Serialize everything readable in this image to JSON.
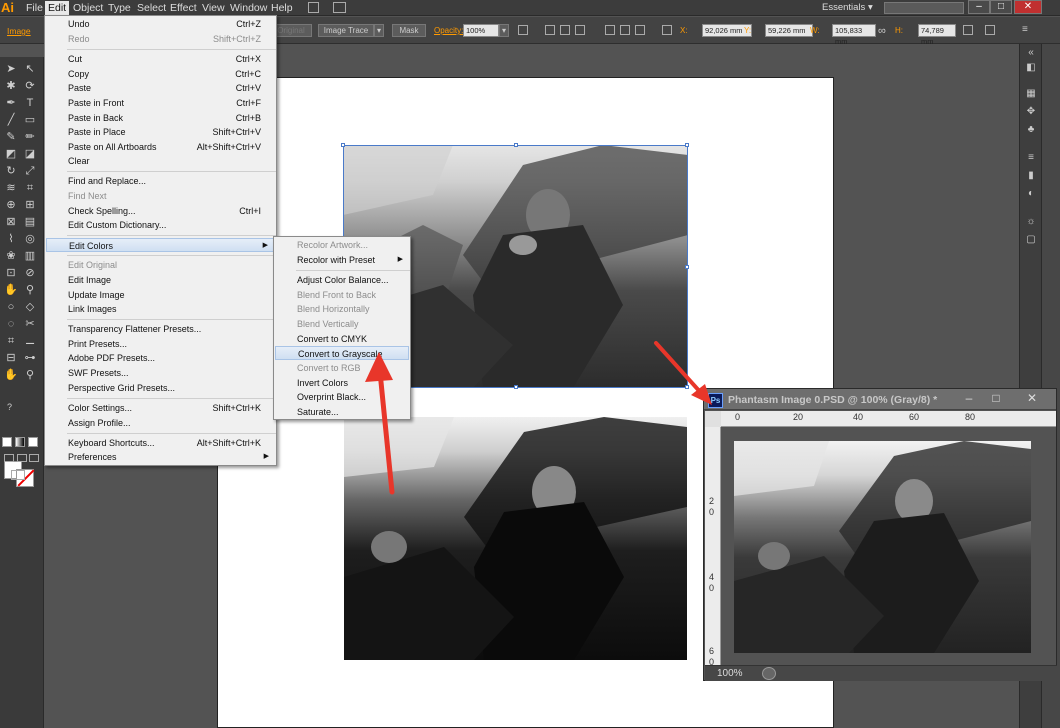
{
  "app": {
    "logo": "Ai"
  },
  "menubar": {
    "items": [
      "File",
      "Edit",
      "Object",
      "Type",
      "Select",
      "Effect",
      "View",
      "Window",
      "Help"
    ],
    "workspace": "Essentials"
  },
  "control_bar": {
    "selection_label": "Image",
    "original_btn": "Original",
    "image_trace_btn": "Image Trace",
    "mask_btn": "Mask",
    "opacity_label": "Opacity:",
    "opacity_value": "100%",
    "x_label": "X:",
    "x_value": "92,026 mm",
    "y_label": "Y:",
    "y_value": "59,226 mm",
    "w_label": "W:",
    "w_value": "105,833 mm",
    "h_label": "H:",
    "h_value": "74,789 mm"
  },
  "edit_menu": {
    "items": [
      {
        "label": "Undo",
        "shortcut": "Ctrl+Z",
        "disabled": false
      },
      {
        "label": "Redo",
        "shortcut": "Shift+Ctrl+Z",
        "disabled": true
      },
      {
        "label": "Cut",
        "shortcut": "Ctrl+X",
        "disabled": false
      },
      {
        "label": "Copy",
        "shortcut": "Ctrl+C",
        "disabled": false
      },
      {
        "label": "Paste",
        "shortcut": "Ctrl+V",
        "disabled": false
      },
      {
        "label": "Paste in Front",
        "shortcut": "Ctrl+F",
        "disabled": false
      },
      {
        "label": "Paste in Back",
        "shortcut": "Ctrl+B",
        "disabled": false
      },
      {
        "label": "Paste in Place",
        "shortcut": "Shift+Ctrl+V",
        "disabled": false
      },
      {
        "label": "Paste on All Artboards",
        "shortcut": "Alt+Shift+Ctrl+V",
        "disabled": false
      },
      {
        "label": "Clear",
        "shortcut": "",
        "disabled": false
      },
      {
        "label": "Find and Replace...",
        "shortcut": "",
        "disabled": false
      },
      {
        "label": "Find Next",
        "shortcut": "",
        "disabled": true
      },
      {
        "label": "Check Spelling...",
        "shortcut": "Ctrl+I",
        "disabled": false
      },
      {
        "label": "Edit Custom Dictionary...",
        "shortcut": "",
        "disabled": false
      },
      {
        "label": "Edit Colors",
        "shortcut": "",
        "disabled": false,
        "submenu": true
      },
      {
        "label": "Edit Original",
        "shortcut": "",
        "disabled": true
      },
      {
        "label": "Edit Image",
        "shortcut": "",
        "disabled": false
      },
      {
        "label": "Update Image",
        "shortcut": "",
        "disabled": false
      },
      {
        "label": "Link Images",
        "shortcut": "",
        "disabled": false
      },
      {
        "label": "Transparency Flattener Presets...",
        "shortcut": "",
        "disabled": false
      },
      {
        "label": "Print Presets...",
        "shortcut": "",
        "disabled": false
      },
      {
        "label": "Adobe PDF Presets...",
        "shortcut": "",
        "disabled": false
      },
      {
        "label": "SWF Presets...",
        "shortcut": "",
        "disabled": false
      },
      {
        "label": "Perspective Grid Presets...",
        "shortcut": "",
        "disabled": false
      },
      {
        "label": "Color Settings...",
        "shortcut": "Shift+Ctrl+K",
        "disabled": false
      },
      {
        "label": "Assign Profile...",
        "shortcut": "",
        "disabled": false
      },
      {
        "label": "Keyboard Shortcuts...",
        "shortcut": "Alt+Shift+Ctrl+K",
        "disabled": false
      },
      {
        "label": "Preferences",
        "shortcut": "",
        "disabled": false,
        "submenu": true
      }
    ]
  },
  "edit_colors_submenu": {
    "items": [
      {
        "label": "Recolor Artwork...",
        "disabled": true
      },
      {
        "label": "Recolor with Preset",
        "disabled": false,
        "submenu": true
      },
      {
        "label": "Adjust Color Balance...",
        "disabled": false
      },
      {
        "label": "Blend Front to Back",
        "disabled": true
      },
      {
        "label": "Blend Horizontally",
        "disabled": true
      },
      {
        "label": "Blend Vertically",
        "disabled": true
      },
      {
        "label": "Convert to CMYK",
        "disabled": false
      },
      {
        "label": "Convert to Grayscale",
        "disabled": false,
        "highlighted": true
      },
      {
        "label": "Convert to RGB",
        "disabled": true
      },
      {
        "label": "Invert Colors",
        "disabled": false
      },
      {
        "label": "Overprint Black...",
        "disabled": false
      },
      {
        "label": "Saturate...",
        "disabled": false
      }
    ]
  },
  "ps_window": {
    "badge": "Ps",
    "title": "Phantasm Image 0.PSD @ 100% (Gray/8) *",
    "ruler_top": [
      "0",
      "20",
      "40",
      "60",
      "80"
    ],
    "ruler_left": [
      "2",
      "0",
      "4",
      "0",
      "6",
      "0"
    ],
    "zoom": "100%"
  },
  "colors": {
    "arrow": "#e8362a",
    "highlight": "#cfdff2",
    "brand": "#ff9a00"
  }
}
